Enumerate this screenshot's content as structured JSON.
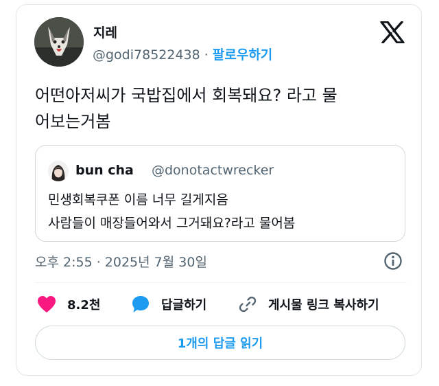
{
  "author": {
    "name": "지레",
    "handle": "@godi78522438",
    "separator": "·",
    "follow_label": "팔로우하기"
  },
  "tweet": {
    "line1": "어떤아저씨가 국밥집에서 회복돼요? 라고 물",
    "line2": "어보는거봄"
  },
  "quote": {
    "name": "bun cha",
    "handle": "@donotactwrecker",
    "line1": "민생회복쿠폰 이름 너무 길게지음",
    "line2": "사람들이 매장들어와서 그거돼요?라고 물어봄"
  },
  "meta": {
    "timestamp": "오후 2:55 · 2025년 7월 30일"
  },
  "actions": {
    "likes": "8.2천",
    "reply": "답글하기",
    "copy_link": "게시물 링크 복사하기"
  },
  "read_replies": "1개의 답글 읽기",
  "colors": {
    "accent": "#1d9bf0",
    "like": "#f91880",
    "muted": "#536471"
  },
  "icons": [
    "x-logo-icon",
    "info-icon",
    "heart-icon",
    "reply-bubble-icon",
    "link-icon"
  ]
}
